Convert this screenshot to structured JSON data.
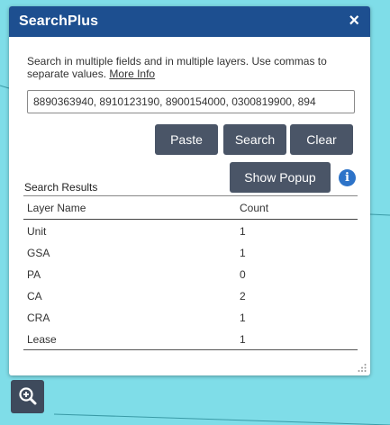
{
  "widget": {
    "title": "SearchPlus",
    "close_glyph": "×",
    "description": "Search in multiple fields and in multiple layers. Use commas to separate values.",
    "more_info_link": "More Info",
    "search_value": "8890363940, 8910123190, 8900154000, 0300819900, 894",
    "buttons": {
      "paste": "Paste",
      "search": "Search",
      "clear": "Clear",
      "show_popup": "Show Popup"
    },
    "info_glyph": "i"
  },
  "results": {
    "heading": "Search Results",
    "columns": [
      "Layer Name",
      "Count"
    ],
    "rows": [
      {
        "layer": "Unit",
        "count": "1"
      },
      {
        "layer": "GSA",
        "count": "1"
      },
      {
        "layer": "PA",
        "count": "0"
      },
      {
        "layer": "CA",
        "count": "2"
      },
      {
        "layer": "CRA",
        "count": "1"
      },
      {
        "layer": "Lease",
        "count": "1"
      }
    ]
  },
  "map_controls": {
    "zoom_icon": "zoom-in-magnifier"
  },
  "colors": {
    "titlebar": "#1d4f90",
    "button": "#4a5567",
    "map_background": "#7fdde8",
    "info_icon": "#2d73c8"
  }
}
